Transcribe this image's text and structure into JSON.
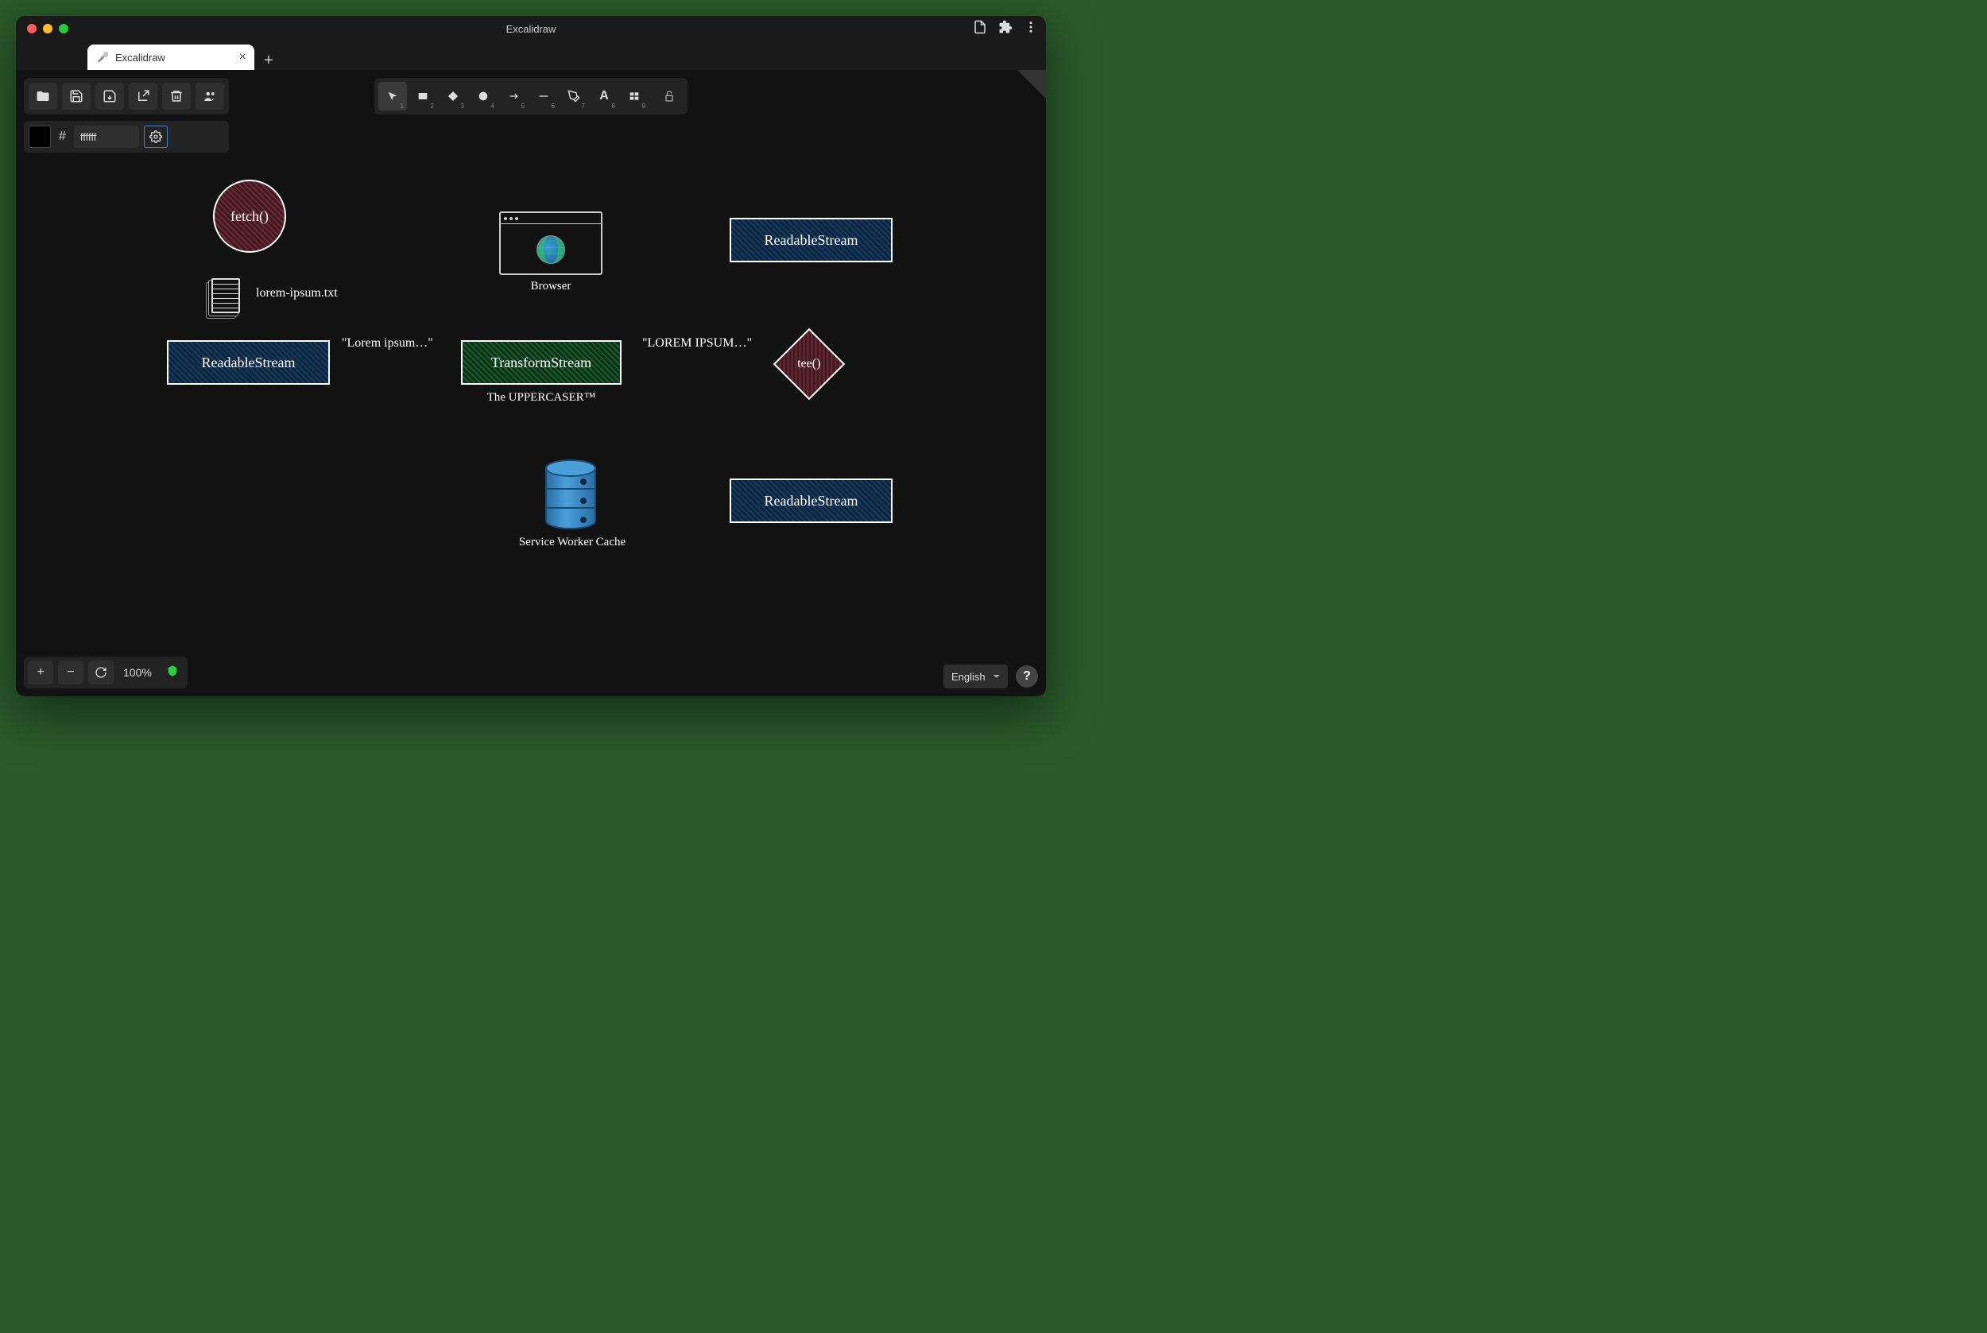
{
  "window": {
    "title": "Excalidraw",
    "tab_title": "Excalidraw"
  },
  "toolbar": {
    "tools": [
      "selection",
      "rectangle",
      "diamond",
      "ellipse",
      "arrow",
      "line",
      "draw",
      "text",
      "image"
    ],
    "tool_numbers": [
      "1",
      "2",
      "3",
      "4",
      "5",
      "6",
      "7",
      "8",
      "9"
    ]
  },
  "color": {
    "hash": "#",
    "hex": "ffffff"
  },
  "zoom": {
    "label": "100%"
  },
  "lang": {
    "selected": "English"
  },
  "diagram": {
    "fetch": "fetch()",
    "file_label": "lorem-ipsum.txt",
    "readable1": "ReadableStream",
    "arrow_text_lorem": "\"Lorem ipsum…\"",
    "transform": "TransformStream",
    "transform_sub": "The UPPERCASER™",
    "arrow_text_upper": "\"LOREM IPSUM…\"",
    "tee": "tee()",
    "readable2": "ReadableStream",
    "readable3": "ReadableStream",
    "browser_label": "Browser",
    "cache_label": "Service Worker Cache"
  }
}
